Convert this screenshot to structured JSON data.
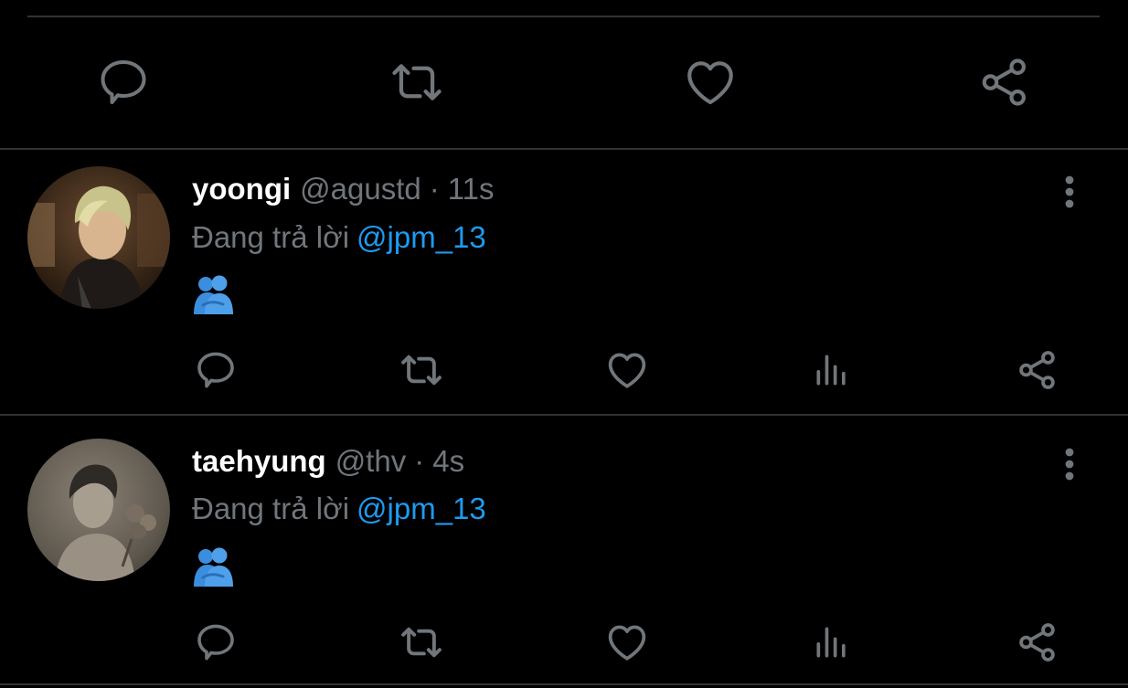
{
  "colors": {
    "background": "#000000",
    "divider": "#2f3336",
    "icon": "#71767b",
    "secondary_text": "#71767b",
    "primary_text": "#ffffff",
    "mention": "#1d9bf0",
    "emoji_blue": "#3b8ede"
  },
  "main_actions": {
    "icons": [
      "reply-icon",
      "retweet-icon",
      "like-icon",
      "share-icon"
    ]
  },
  "tweets": [
    {
      "display_name": "yoongi",
      "handle": "@agustd",
      "separator": "·",
      "time": "11s",
      "reply_prefix": "Đang trả lời",
      "reply_to": "@jpm_13",
      "emoji": "people-hugging-emoji",
      "action_icons": [
        "reply-icon",
        "retweet-icon",
        "like-icon",
        "views-icon",
        "share-icon"
      ]
    },
    {
      "display_name": "taehyung",
      "handle": "@thv",
      "separator": "·",
      "time": "4s",
      "reply_prefix": "Đang trả lời",
      "reply_to": "@jpm_13",
      "emoji": "people-hugging-emoji",
      "action_icons": [
        "reply-icon",
        "retweet-icon",
        "like-icon",
        "views-icon",
        "share-icon"
      ]
    }
  ]
}
